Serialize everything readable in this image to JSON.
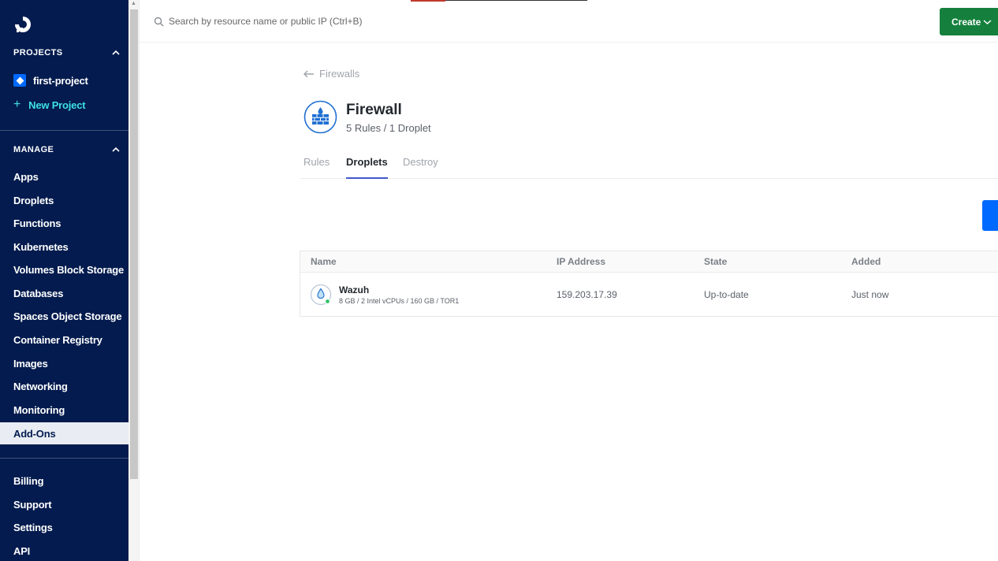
{
  "sidebar": {
    "projects_heading": "PROJECTS",
    "projects": [
      {
        "label": "first-project"
      }
    ],
    "new_project_label": "New Project",
    "manage_heading": "MANAGE",
    "manage_items": [
      {
        "label": "Apps"
      },
      {
        "label": "Droplets"
      },
      {
        "label": "Functions"
      },
      {
        "label": "Kubernetes"
      },
      {
        "label": "Volumes Block Storage"
      },
      {
        "label": "Databases"
      },
      {
        "label": "Spaces Object Storage"
      },
      {
        "label": "Container Registry"
      },
      {
        "label": "Images"
      },
      {
        "label": "Networking"
      },
      {
        "label": "Monitoring"
      },
      {
        "label": "Add-Ons",
        "active": true
      }
    ],
    "account_items": [
      {
        "label": "Billing"
      },
      {
        "label": "Support"
      },
      {
        "label": "Settings"
      },
      {
        "label": "API"
      }
    ]
  },
  "topbar": {
    "search_placeholder": "Search by resource name or public IP (Ctrl+B)",
    "create_label": "Create"
  },
  "page": {
    "back_label": "Firewalls",
    "title": "Firewall",
    "subtitle": "5 Rules / 1 Droplet",
    "tabs": [
      {
        "label": "Rules",
        "active": false
      },
      {
        "label": "Droplets",
        "active": true
      },
      {
        "label": "Destroy",
        "active": false
      }
    ]
  },
  "table": {
    "headers": [
      "Name",
      "IP Address",
      "State",
      "Added"
    ],
    "rows": [
      {
        "name": "Wazuh",
        "spec": "8 GB / 2 Intel vCPUs / 160 GB / TOR1",
        "ip": "159.203.17.39",
        "state": "Up-to-date",
        "added": "Just now"
      }
    ]
  },
  "colors": {
    "sidebar_bg": "#031b4e",
    "create_button": "#15803d",
    "accent_blue": "#0069ff",
    "new_project_text": "#3ee0e6"
  }
}
